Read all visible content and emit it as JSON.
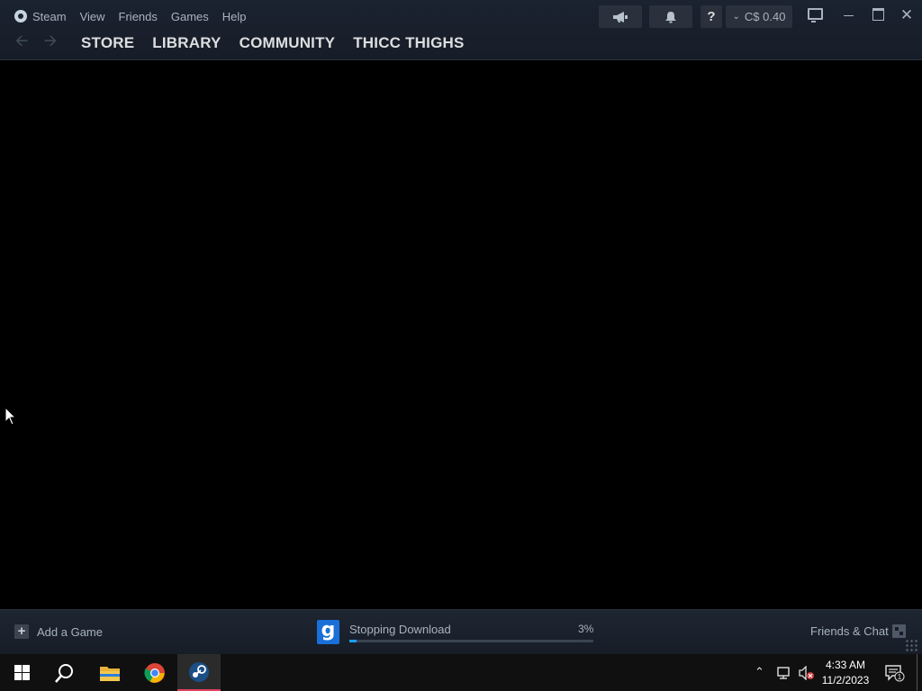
{
  "menu": {
    "items": [
      "Steam",
      "View",
      "Friends",
      "Games",
      "Help"
    ]
  },
  "nav": {
    "store": "STORE",
    "library": "LIBRARY",
    "community": "COMMUNITY",
    "user": "THICC THIGHS"
  },
  "header": {
    "help_label": "?",
    "wallet_chevron": "⌄",
    "wallet_balance": "C$ 0.40"
  },
  "bottom": {
    "add_game": "Add a Game",
    "download_game_icon_letter": "g",
    "download_status": "Stopping Download",
    "download_percent_label": "3%",
    "download_progress": 0.03,
    "friends_chat": "Friends & Chat"
  },
  "taskbar": {
    "time": "4:33 AM",
    "date": "11/2/2023",
    "notifications_count": "1"
  },
  "colors": {
    "accent_blue": "#1a9fff",
    "header_bg": "#1b2230",
    "taskbar_active": "#e0405e"
  }
}
